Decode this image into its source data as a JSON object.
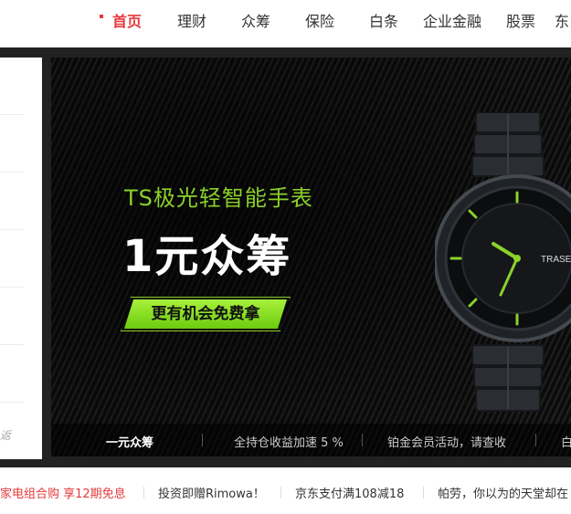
{
  "nav": {
    "items": [
      {
        "label": "首页",
        "active": true
      },
      {
        "label": "理财",
        "active": false
      },
      {
        "label": "众筹",
        "active": false
      },
      {
        "label": "保险",
        "active": false
      },
      {
        "label": "白条",
        "active": false
      },
      {
        "label": "企业金融",
        "active": false
      },
      {
        "label": "股票",
        "active": false
      },
      {
        "label": "东",
        "active": false
      }
    ]
  },
  "leftpanel": {
    "more_label": "返"
  },
  "banner": {
    "subtitle": "TS极光轻智能手表",
    "headline": "1元众筹",
    "cta_label": "更有机会免费拿",
    "watch_brand": "TRASE",
    "accent_color": "#8bd12a"
  },
  "tabs": [
    {
      "label": "一元众筹",
      "active": true
    },
    {
      "label": "全持仓收益加速 5 %",
      "active": false
    },
    {
      "label": "铂金会员活动，请查收",
      "active": false
    },
    {
      "label": "白",
      "active": false
    }
  ],
  "ticker": [
    {
      "label": "家电组合购 享12期免息",
      "hot": true
    },
    {
      "label": "投资即赠Rimowa！",
      "hot": false
    },
    {
      "label": "京东支付满108减18",
      "hot": false
    },
    {
      "label": "帕劳，你以为的天堂却在",
      "hot": false
    }
  ]
}
